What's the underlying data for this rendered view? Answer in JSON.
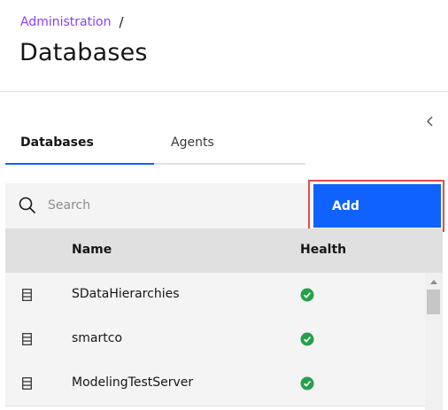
{
  "breadcrumb": {
    "link": "Administration",
    "separator": "/"
  },
  "page": {
    "title": "Databases"
  },
  "tabs": [
    {
      "label": "Databases",
      "active": true
    },
    {
      "label": "Agents",
      "active": false
    }
  ],
  "search": {
    "placeholder": "Search",
    "value": ""
  },
  "toolbar": {
    "add_label": "Add"
  },
  "table": {
    "columns": [
      "Name",
      "Health"
    ],
    "rows": [
      {
        "name": "SDataHierarchies",
        "health": "healthy"
      },
      {
        "name": "smartco",
        "health": "healthy"
      },
      {
        "name": "ModelingTestServer",
        "health": "healthy"
      }
    ]
  },
  "colors": {
    "accent": "#0f62fe",
    "link": "#8a3ffc",
    "healthy": "#24a148",
    "highlight": "#e34c4c"
  },
  "icons": {
    "search": "search-icon",
    "collapse": "chevron-left-icon",
    "database": "database-icon",
    "health": "checkmark-filled-icon"
  }
}
